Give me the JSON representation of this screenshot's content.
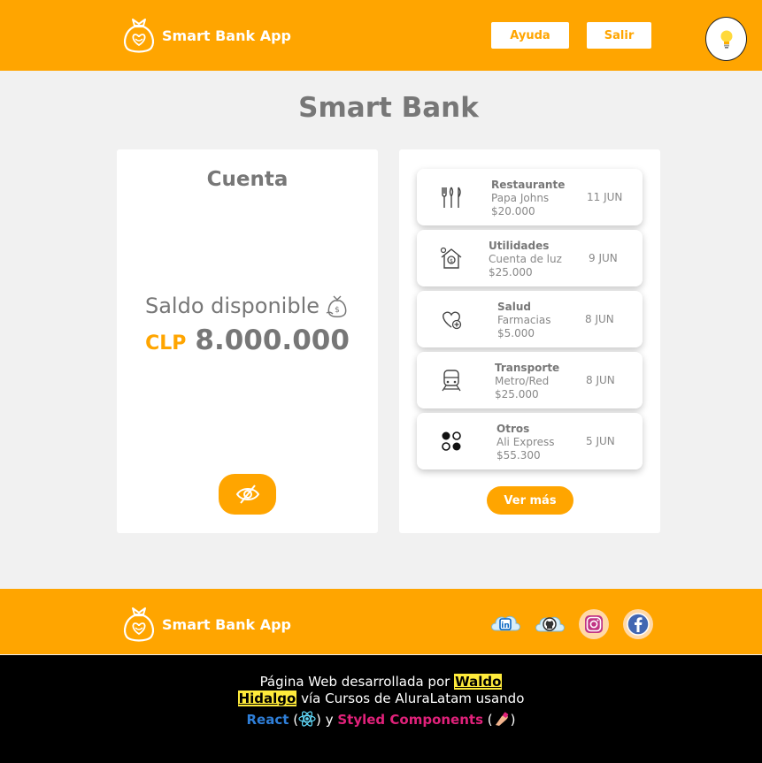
{
  "header": {
    "brand": "Smart Bank App",
    "help_label": "Ayuda",
    "exit_label": "Salir"
  },
  "main": {
    "title": "Smart Bank",
    "account": {
      "title": "Cuenta",
      "balance_label": "Saldo disponible",
      "currency": "CLP",
      "amount": "8.000.000"
    },
    "transactions": [
      {
        "category": "Restaurante",
        "merchant": "Papa Johns",
        "amount": "$20.000",
        "date": "11 JUN",
        "icon": "cutlery-icon"
      },
      {
        "category": "Utilidades",
        "merchant": "Cuenta de luz",
        "amount": "$25.000",
        "date": "9 JUN",
        "icon": "house-bill-icon"
      },
      {
        "category": "Salud",
        "merchant": "Farmacias",
        "amount": "$5.000",
        "date": "8 JUN",
        "icon": "heart-plus-icon"
      },
      {
        "category": "Transporte",
        "merchant": "Metro/Red",
        "amount": "$25.000",
        "date": "8 JUN",
        "icon": "train-icon"
      },
      {
        "category": "Otros",
        "merchant": "Ali Express",
        "amount": "$55.300",
        "date": "5 JUN",
        "icon": "dots-icon"
      }
    ],
    "more_label": "Ver más"
  },
  "footer": {
    "brand": "Smart Bank App",
    "social": [
      "linkedin-icon",
      "github-icon",
      "instagram-icon",
      "facebook-icon"
    ],
    "credits": {
      "prefix": "Página Web desarrollada por",
      "author_first": "Waldo",
      "author_last": "Hidalgo",
      "middle": "vía Cursos de AluraLatam usando",
      "react": "React",
      "and": "y",
      "styled": "Styled Components"
    }
  },
  "colors": {
    "accent": "#ffa500",
    "background": "#f1f1f1",
    "text": "#777777",
    "footer_dark": "#000000"
  }
}
